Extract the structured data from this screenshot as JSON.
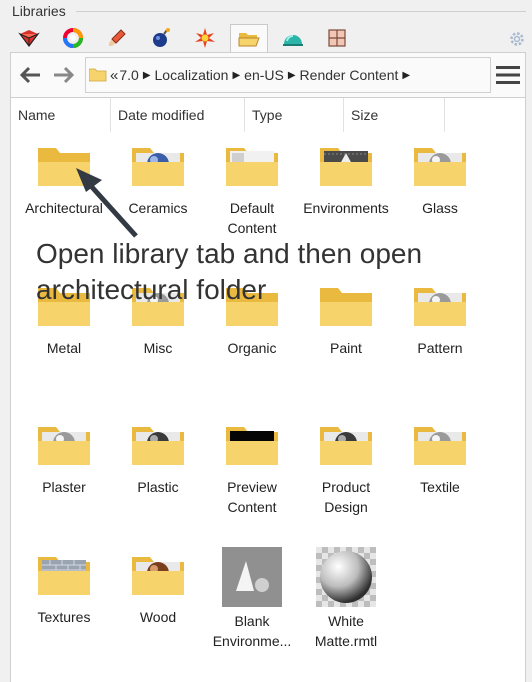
{
  "panel": {
    "title": "Libraries"
  },
  "tabs": [
    {
      "name": "materials-tab-icon"
    },
    {
      "name": "environments-tab-icon"
    },
    {
      "name": "textures-tab-icon"
    },
    {
      "name": "sun-tab-icon"
    },
    {
      "name": "render-effects-tab-icon"
    },
    {
      "name": "libraries-folder-tab-icon",
      "active": true
    },
    {
      "name": "ground-plane-tab-icon"
    },
    {
      "name": "grid-tab-icon"
    }
  ],
  "breadcrumb": {
    "overflow": "«",
    "items": [
      "7.0",
      "Localization",
      "en-US",
      "Render Content"
    ]
  },
  "columns": [
    "Name",
    "Date modified",
    "Type",
    "Size"
  ],
  "items": [
    {
      "label": "Architectural",
      "kind": "folder-plain"
    },
    {
      "label": "Ceramics",
      "kind": "folder-sphere-blue"
    },
    {
      "label": "Default Content",
      "kind": "folder-doc"
    },
    {
      "label": "Environments",
      "kind": "folder-env"
    },
    {
      "label": "Glass",
      "kind": "folder-sphere-grey"
    },
    {
      "label": "Metal",
      "kind": "folder-plain"
    },
    {
      "label": "Misc",
      "kind": "folder-sphere-grey"
    },
    {
      "label": "Organic",
      "kind": "folder-plain"
    },
    {
      "label": "Paint",
      "kind": "folder-plain"
    },
    {
      "label": "Pattern",
      "kind": "folder-sphere-grey"
    },
    {
      "label": "Plaster",
      "kind": "folder-sphere-grey"
    },
    {
      "label": "Plastic",
      "kind": "folder-sphere-dark"
    },
    {
      "label": "Preview Content",
      "kind": "folder-black"
    },
    {
      "label": "Product Design",
      "kind": "folder-sphere-dark"
    },
    {
      "label": "Textile",
      "kind": "folder-sphere-grey"
    },
    {
      "label": "Textures",
      "kind": "folder-brick"
    },
    {
      "label": "Wood",
      "kind": "folder-sphere-brown"
    },
    {
      "label": "Blank Environme...",
      "kind": "env-thumb"
    },
    {
      "label": "White Matte.rmtl",
      "kind": "material-thumb"
    }
  ],
  "annotation": {
    "text": "Open library tab and then open architectural folder"
  },
  "colors": {
    "folder": "#f7d36b",
    "folderDark": "#eab93f",
    "accent": "#3a73c8"
  }
}
